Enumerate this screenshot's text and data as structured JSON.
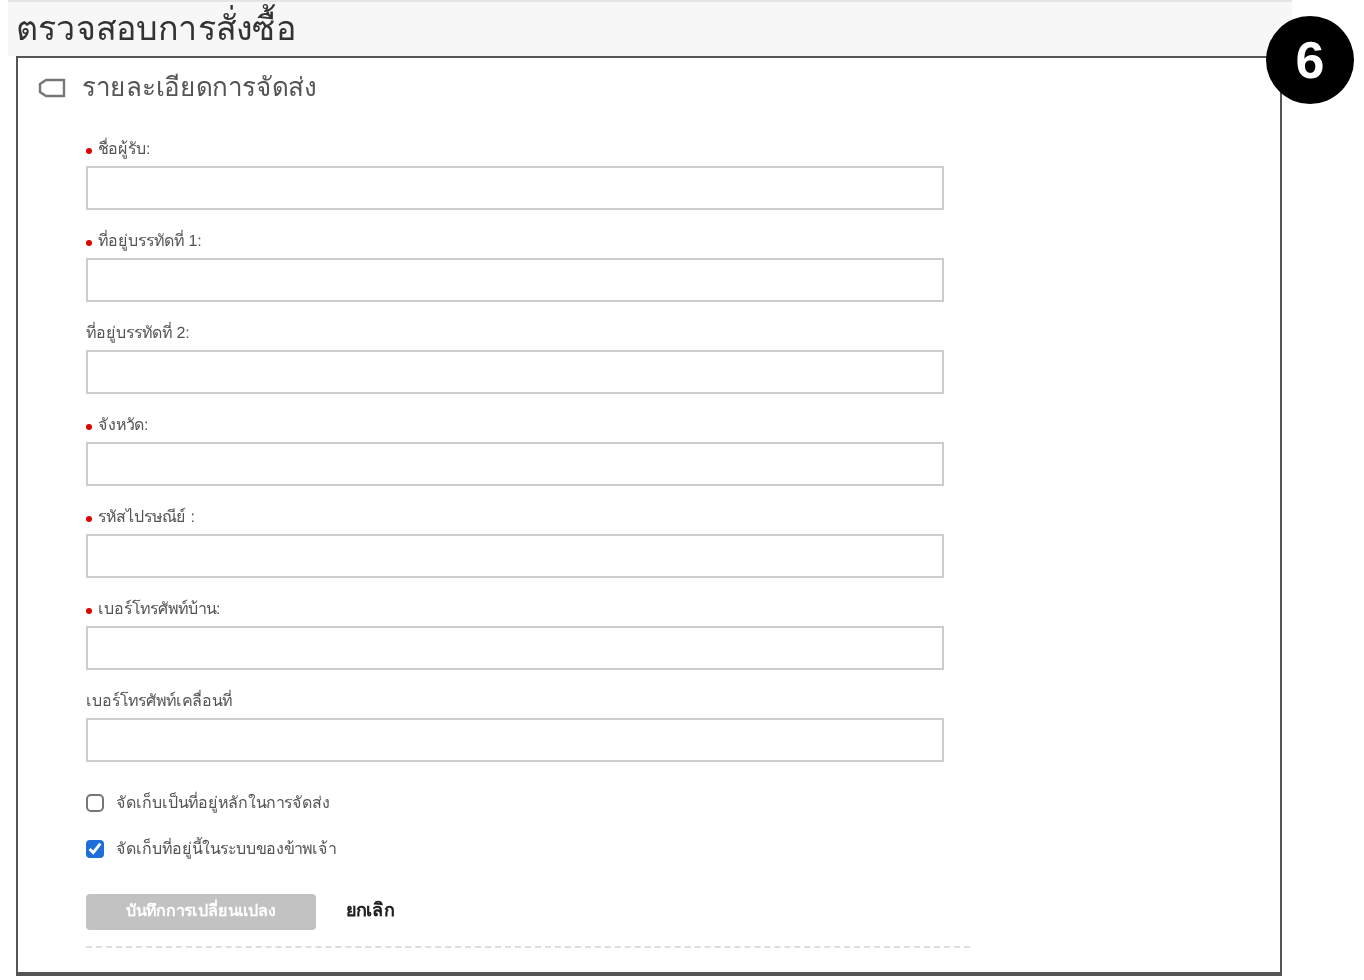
{
  "page_title": "ตรวจสอบการสั่งซื้อ",
  "step_badge": "6",
  "panel": {
    "title": "รายละเอียดการจัดส่ง"
  },
  "fields": [
    {
      "label": "ชื่อผู้รับ:",
      "required": true
    },
    {
      "label": "ที่อยู่บรรทัดที่ 1:",
      "required": true
    },
    {
      "label": "ที่อยู่บรรทัดที่ 2:",
      "required": false
    },
    {
      "label": "จังหวัด:",
      "required": true
    },
    {
      "label": "รหัสไปรษณีย์ :",
      "required": true
    },
    {
      "label": "เบอร์โทรศัพท์บ้าน:",
      "required": true
    },
    {
      "label": "เบอร์โทรศัพท์เคลื่อนที่",
      "required": false
    }
  ],
  "checkboxes": [
    {
      "label": "จัดเก็บเป็นที่อยู่หลักในการจัดส่ง",
      "checked": false
    },
    {
      "label": "จัดเก็บที่อยู่นี้ในระบบของข้าพเจ้า",
      "checked": true
    }
  ],
  "save_button": {
    "label": "บันทึกการเปลี่ยนแปลง",
    "disabled": true
  },
  "cancel_link": {
    "label": "ยกเลิก"
  }
}
